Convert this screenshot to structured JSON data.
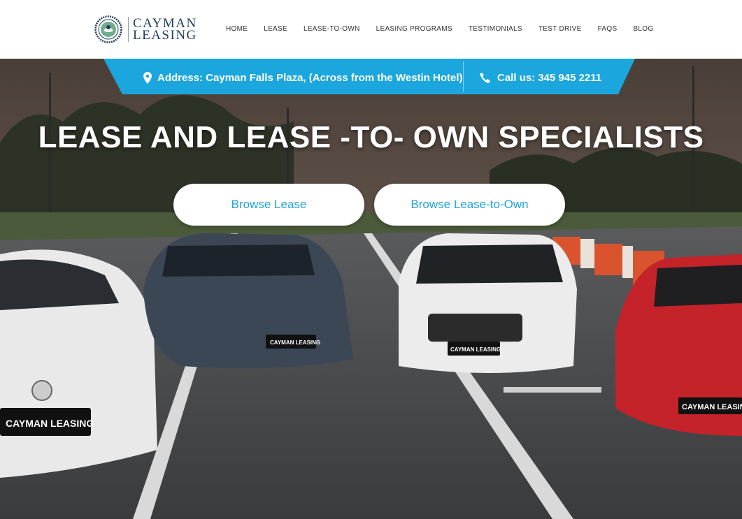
{
  "brand": {
    "line1": "CAYMAN",
    "line2": "LEASING"
  },
  "nav": {
    "items": [
      "HOME",
      "LEASE",
      "LEASE-TO-OWN",
      "LEASING PROGRAMS",
      "TESTIMONIALS",
      "TEST DRIVE",
      "FAQS",
      "BLOG"
    ]
  },
  "info": {
    "address": "Address: Cayman Falls Plaza, (Across from the Westin Hotel)",
    "call_label": "Call us:",
    "phone": "345 945 2211"
  },
  "hero": {
    "headline": "LEASE AND LEASE -TO- OWN SPECIALISTS",
    "btn_lease": "Browse Lease",
    "btn_lto": "Browse Lease-to-Own",
    "plate_text": "CAYMAN LEASING"
  },
  "colors": {
    "accent": "#1fa5d8",
    "ribbon": "#1ba7dd",
    "logo_navy": "#1f3d5c",
    "header_bg": "#ffffff"
  },
  "icons": [
    "map-pin-icon",
    "phone-icon",
    "cayman-leasing-logo"
  ]
}
